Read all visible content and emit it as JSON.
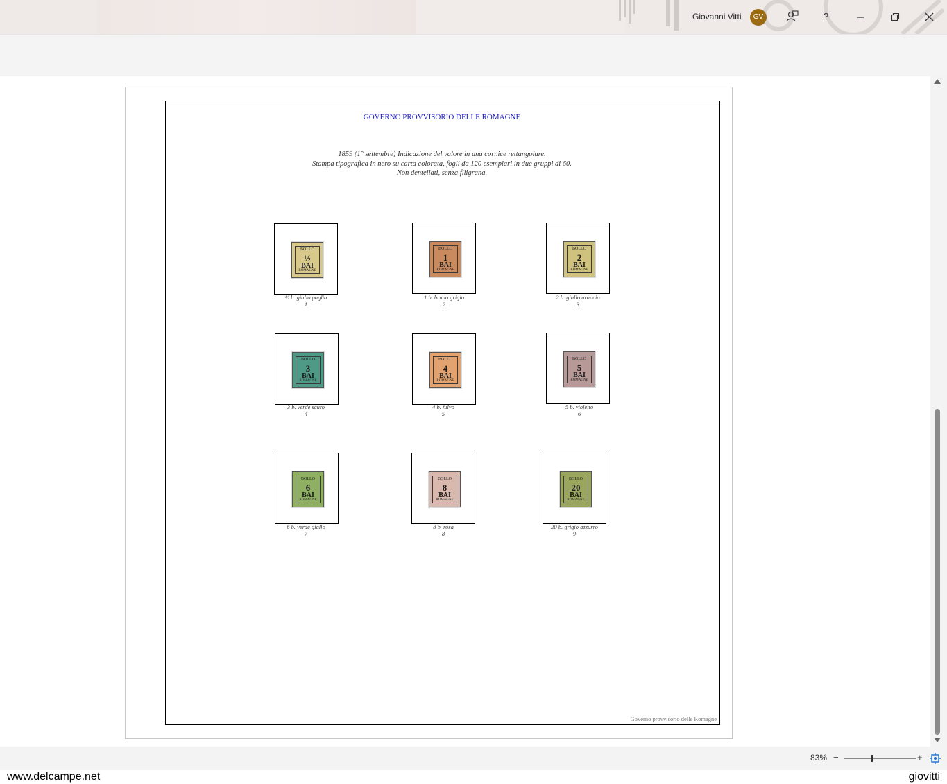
{
  "window": {
    "user_name": "Giovanni Vitti",
    "user_initials": "GV",
    "help_label": "?"
  },
  "document": {
    "title": "GOVERNO PROVVISORIO DELLE ROMAGNE",
    "description": [
      "1859 (1° settembre) Indicazione del valore in una cornice rettangolare.",
      "Stampa tipografica in nero su carta colorata, fogli da 120 esemplari in due gruppi di 60.",
      "Non dentellati, senza filigrana."
    ],
    "footer": "Governo provvisorio delle Romagne",
    "stamp_text": {
      "top": "BOLLO",
      "bottom": "ROMAGNE",
      "unit": "BAI"
    },
    "stamps": [
      {
        "value": "½",
        "caption": "½ b. giallo paglia",
        "number": "1",
        "color": "#d8c98a"
      },
      {
        "value": "1",
        "caption": "1 b. bruno grigio",
        "number": "2",
        "color": "#c98a5e"
      },
      {
        "value": "2",
        "caption": "2 b. giallo arancio",
        "number": "3",
        "color": "#cfc27f"
      },
      {
        "value": "3",
        "caption": "3 b. verde scuro",
        "number": "4",
        "color": "#4f9a86"
      },
      {
        "value": "4",
        "caption": "4 b. fulvo",
        "number": "5",
        "color": "#e2a370"
      },
      {
        "value": "5",
        "caption": "5 b. violetto",
        "number": "6",
        "color": "#b79a98"
      },
      {
        "value": "6",
        "caption": "6 b. verde giallo",
        "number": "7",
        "color": "#8fb062"
      },
      {
        "value": "8",
        "caption": "8 b. rosa",
        "number": "8",
        "color": "#d9b8ad"
      },
      {
        "value": "20",
        "caption": "20 b. grigio azzurro",
        "number": "9",
        "color": "#9aa55e"
      }
    ]
  },
  "statusbar": {
    "zoom": "83%",
    "zoom_minus": "−",
    "zoom_plus": "+"
  },
  "watermark": {
    "left": "www.delcampe.net",
    "right": "giovitti"
  }
}
